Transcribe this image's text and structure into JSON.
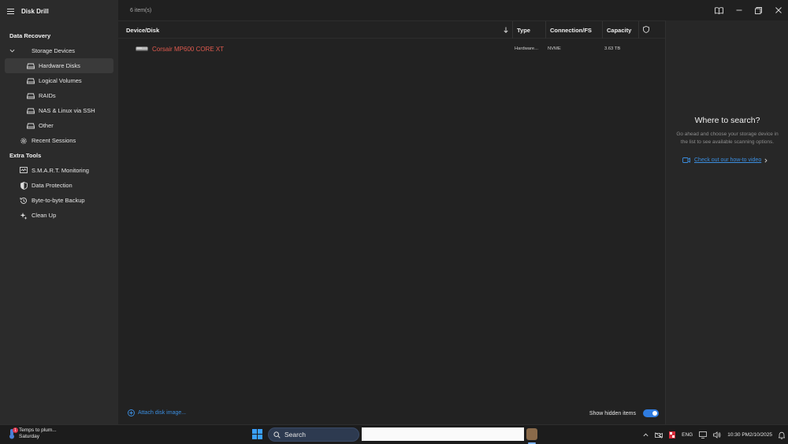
{
  "app": {
    "title": "Disk Drill"
  },
  "sidebar": {
    "data_recovery_heading": "Data Recovery",
    "storage_devices": "Storage Devices",
    "items": [
      {
        "label": "Hardware Disks",
        "active": true
      },
      {
        "label": "Logical Volumes"
      },
      {
        "label": "RAIDs"
      },
      {
        "label": "NAS & Linux via SSH"
      },
      {
        "label": "Other"
      }
    ],
    "recent_sessions": "Recent Sessions",
    "extra_tools_heading": "Extra Tools",
    "tools": [
      {
        "label": "S.M.A.R.T. Monitoring",
        "icon": "monitor-icon"
      },
      {
        "label": "Data Protection",
        "icon": "shield-icon"
      },
      {
        "label": "Byte-to-byte Backup",
        "icon": "history-icon"
      },
      {
        "label": "Clean Up",
        "icon": "sparkle-icon"
      }
    ]
  },
  "main": {
    "items_count": "6 item(s)",
    "columns": {
      "device": "Device/Disk",
      "type": "Type",
      "connection": "Connection/FS",
      "capacity": "Capacity"
    },
    "rows": [
      {
        "name": "Corsair MP600 CORE XT",
        "type": "Hardware...",
        "connection": "NVME",
        "capacity": "3.63 TB"
      }
    ],
    "attach_label": "Attach disk image...",
    "show_hidden_label": "Show hidden items",
    "show_hidden_on": true
  },
  "right_panel": {
    "title": "Where to search?",
    "description": "Go ahead and choose your storage device in the list to see available scanning options.",
    "link": "Check out our how-to video"
  },
  "taskbar": {
    "weather_title": "Temps to plum...",
    "weather_sub": "Saturday",
    "weather_badge": "1",
    "search_label": "Search",
    "language": "ENG",
    "time": "10:30 PM",
    "date": "2/10/2025"
  },
  "colors": {
    "accent": "#2f7ce0",
    "link": "#3b8ee0",
    "disk_name": "#e05a4e"
  }
}
